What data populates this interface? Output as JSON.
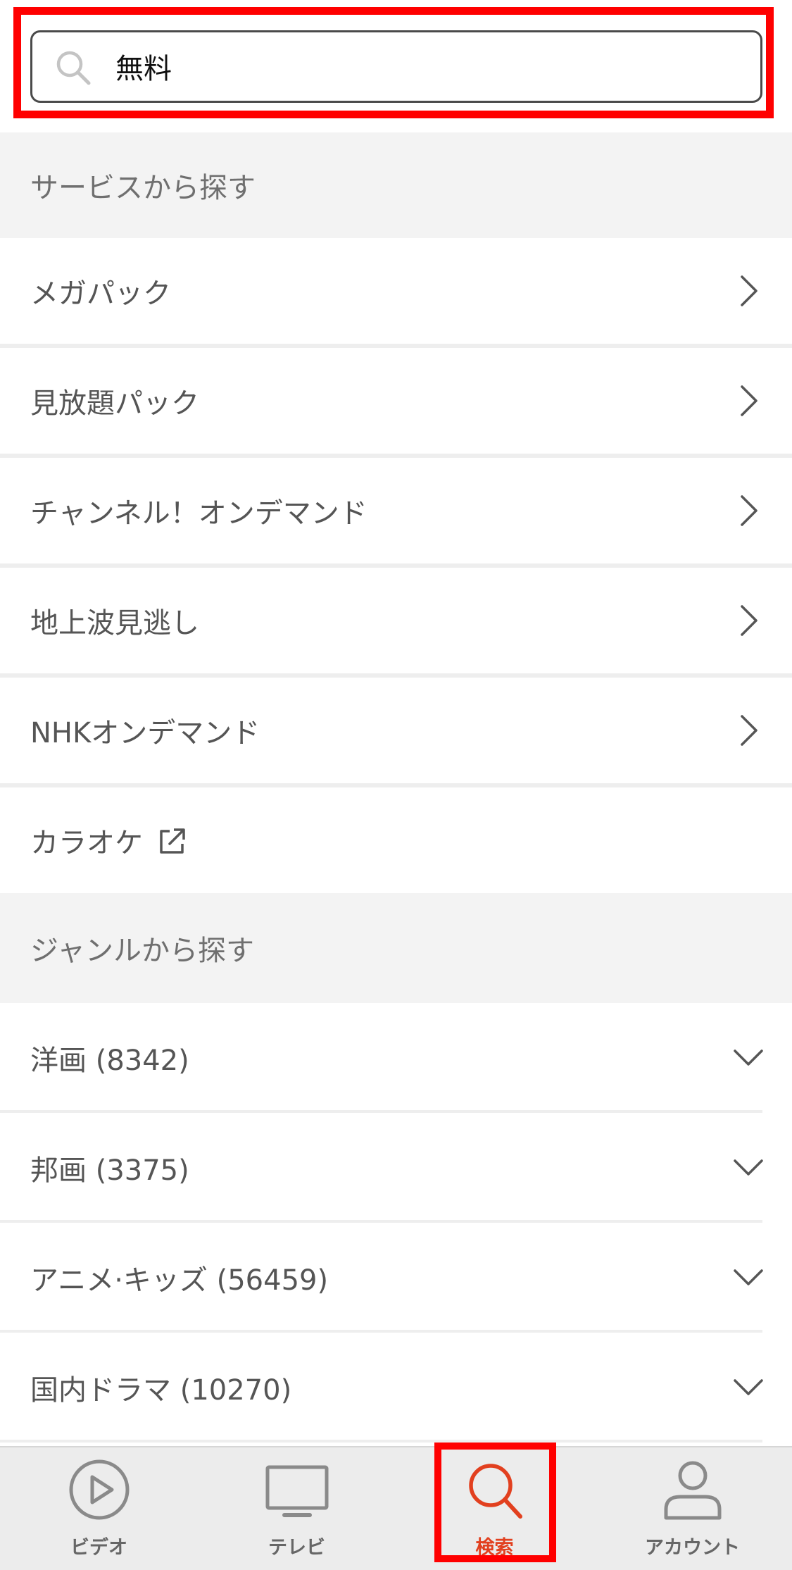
{
  "search": {
    "value": "無料",
    "placeholder": ""
  },
  "services": {
    "header": "サービスから探す",
    "items": [
      {
        "label": "メガパック"
      },
      {
        "label": "見放題パック"
      },
      {
        "label": "チャンネル！オンデマンド"
      },
      {
        "label": "地上波見逃し"
      },
      {
        "label": "NHKオンデマンド"
      },
      {
        "label": "カラオケ"
      }
    ]
  },
  "genres": {
    "header": "ジャンルから探す",
    "items": [
      {
        "label": "洋画 (8342)"
      },
      {
        "label": "邦画 (3375)"
      },
      {
        "label": "アニメ·キッズ (56459)"
      },
      {
        "label": "国内ドラマ (10270)"
      }
    ]
  },
  "nav": {
    "items": [
      {
        "label": "ビデオ",
        "icon": "play-circle-icon"
      },
      {
        "label": "テレビ",
        "icon": "tv-icon"
      },
      {
        "label": "検索",
        "icon": "search-icon"
      },
      {
        "label": "アカウント",
        "icon": "user-icon"
      }
    ],
    "active_index": 2
  },
  "colors": {
    "accent": "#e2401f",
    "highlight": "#ff0000",
    "section_bg": "#f3f3f3",
    "nav_bg": "#ececec"
  }
}
